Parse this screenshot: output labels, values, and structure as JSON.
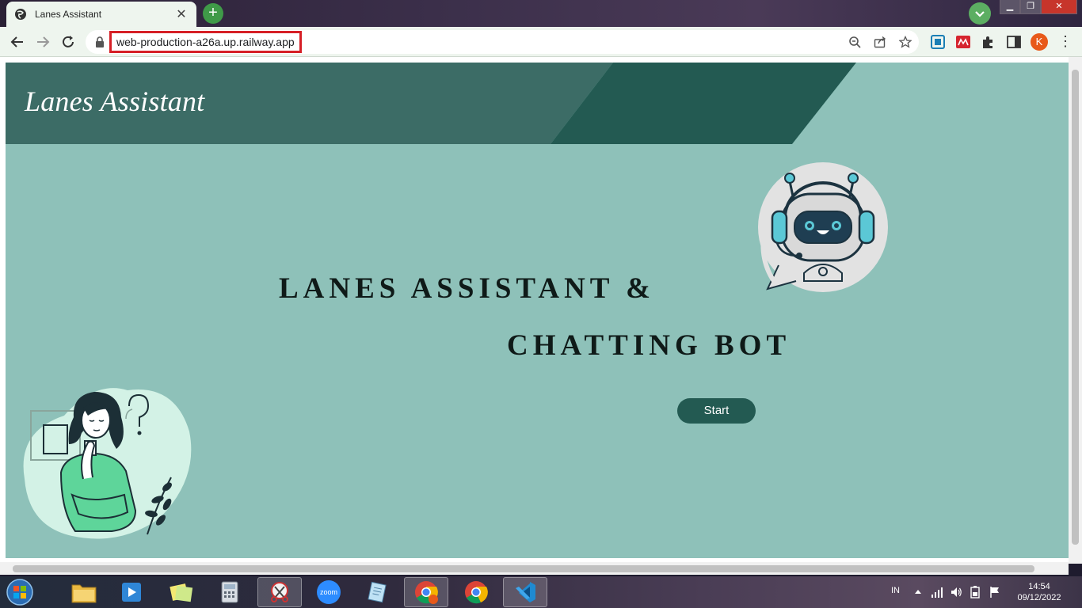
{
  "browser": {
    "tab_title": "Lanes Assistant",
    "tab_close": "✕",
    "new_tab": "+",
    "url": "web-production-a26a.up.railway.app",
    "profile_initial": "K",
    "menu": "⋮",
    "window_controls": {
      "minimize": "▁",
      "maximize": "❐",
      "close": "✕"
    }
  },
  "page": {
    "brand": "Lanes Assistant",
    "headline_line1": "LANES ASSISTANT &",
    "headline_line2": "CHATTING BOT",
    "start_button": "Start",
    "colors": {
      "background": "#8ec1b9",
      "header_left": "#3c6c66",
      "header_band": "#235a52",
      "button": "#235a52"
    }
  },
  "taskbar": {
    "language": "IN",
    "time": "14:54",
    "date": "09/12/2022",
    "apps": [
      "file-explorer",
      "media-player",
      "sticky-notes",
      "calculator",
      "snipping-tool",
      "zoom",
      "notepad",
      "chrome-profile",
      "chrome",
      "vscode"
    ],
    "zoom_label": "zoom"
  }
}
